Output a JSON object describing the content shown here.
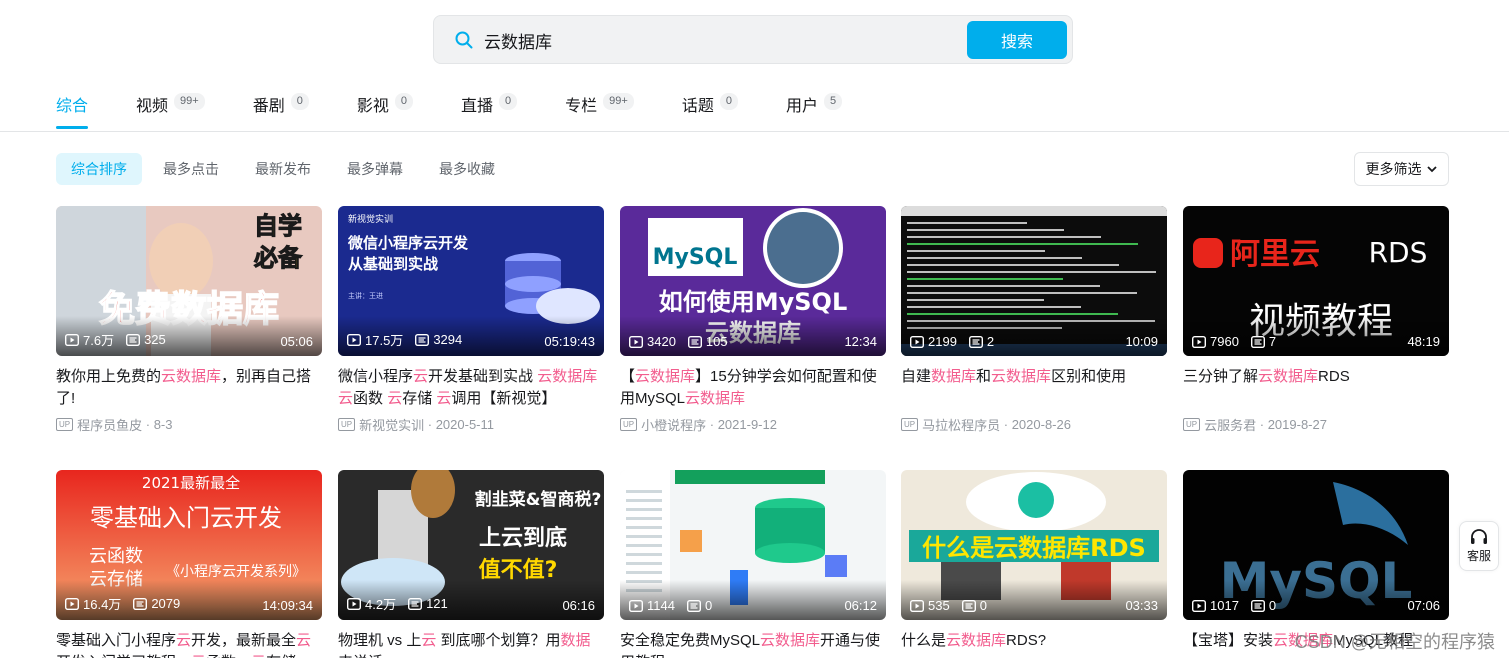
{
  "search": {
    "value": "云数据库",
    "button": "搜索"
  },
  "tabs": [
    {
      "label": "综合",
      "count": "",
      "active": true
    },
    {
      "label": "视频",
      "count": "99+"
    },
    {
      "label": "番剧",
      "count": "0"
    },
    {
      "label": "影视",
      "count": "0"
    },
    {
      "label": "直播",
      "count": "0"
    },
    {
      "label": "专栏",
      "count": "99+"
    },
    {
      "label": "话题",
      "count": "0"
    },
    {
      "label": "用户",
      "count": "5"
    }
  ],
  "sort": [
    "综合排序",
    "最多点击",
    "最新发布",
    "最多弹幕",
    "最多收藏"
  ],
  "more_filter": "更多筛选",
  "videos": [
    {
      "views": "7.6万",
      "danmaku": "325",
      "duration": "05:06",
      "title": "教你用上免费的[[云数据库]]，别再自己搭了!",
      "thumb_text": [
        "自学",
        "必备",
        "免费数据库"
      ],
      "author": "程序员鱼皮",
      "date": "8-3"
    },
    {
      "views": "17.5万",
      "danmaku": "3294",
      "duration": "05:19:43",
      "title": "微信小程序[[云]]开发基础到实战 [[云数据库]] [[云]]函数 [[云]]存储 [[云]]调用【新视觉】",
      "thumb_text": [
        "新视觉实训",
        "微信小程序云开发",
        "从基础到实战",
        "主讲：王进"
      ],
      "author": "新视觉实训",
      "date": "2020-5-11"
    },
    {
      "views": "3420",
      "danmaku": "105",
      "duration": "12:34",
      "title": "【[[云数据库]]】15分钟学会如何配置和使用MySQL[[云数据库]]",
      "thumb_text": [
        "MySQL",
        "如何使用MySQL",
        "云数据库"
      ],
      "author": "小橙说程序",
      "date": "2021-9-12"
    },
    {
      "views": "2199",
      "danmaku": "2",
      "duration": "10:09",
      "title": "自建[[数据库]]和[[云数据库]]区别和使用",
      "thumb_text": [],
      "author": "马拉松程序员",
      "date": "2020-8-26"
    },
    {
      "views": "7960",
      "danmaku": "7",
      "duration": "48:19",
      "title": "三分钟了解[[云数据库]]RDS",
      "thumb_text": [
        "阿里云",
        "RDS",
        "视频教程"
      ],
      "author": "云服务君",
      "date": "2019-8-27"
    },
    {
      "views": "16.4万",
      "danmaku": "2079",
      "duration": "14:09:34",
      "title": "零基础入门小程序[[云]]开发，最新最全[[云]]开发入门学习教程，[[云]]函数，[[云]]存储",
      "thumb_text": [
        "2021最新最全",
        "零基础入门云开发",
        "云函数",
        "云存储",
        "《小程序云开发系列》"
      ],
      "author": "",
      "date": ""
    },
    {
      "views": "4.2万",
      "danmaku": "121",
      "duration": "06:16",
      "title": "物理机 vs 上[[云]] 到底哪个划算？用[[数据]]来说话",
      "thumb_text": [
        "割韭菜&智商税?",
        "上云到底",
        "值不值?"
      ],
      "author": "",
      "date": ""
    },
    {
      "views": "1144",
      "danmaku": "0",
      "duration": "06:12",
      "title": "安全稳定免费MySQL[[云数据库]]开通与使用教程",
      "thumb_text": [],
      "author": "",
      "date": ""
    },
    {
      "views": "535",
      "danmaku": "0",
      "duration": "03:33",
      "title": "什么是[[云数据库]]RDS?",
      "thumb_text": [
        "什么是云数据库RDS"
      ],
      "author": "",
      "date": ""
    },
    {
      "views": "1017",
      "danmaku": "0",
      "duration": "07:06",
      "title": "【宝塔】安装[[云数据库]]MySQL教程",
      "thumb_text": [
        "MySQL"
      ],
      "author": "",
      "date": ""
    }
  ],
  "service_label": "客服",
  "watermark": "CSDN @无相空的程序猿",
  "colors": {
    "accent": "#00aeec",
    "highlight": "#f25d8e"
  }
}
